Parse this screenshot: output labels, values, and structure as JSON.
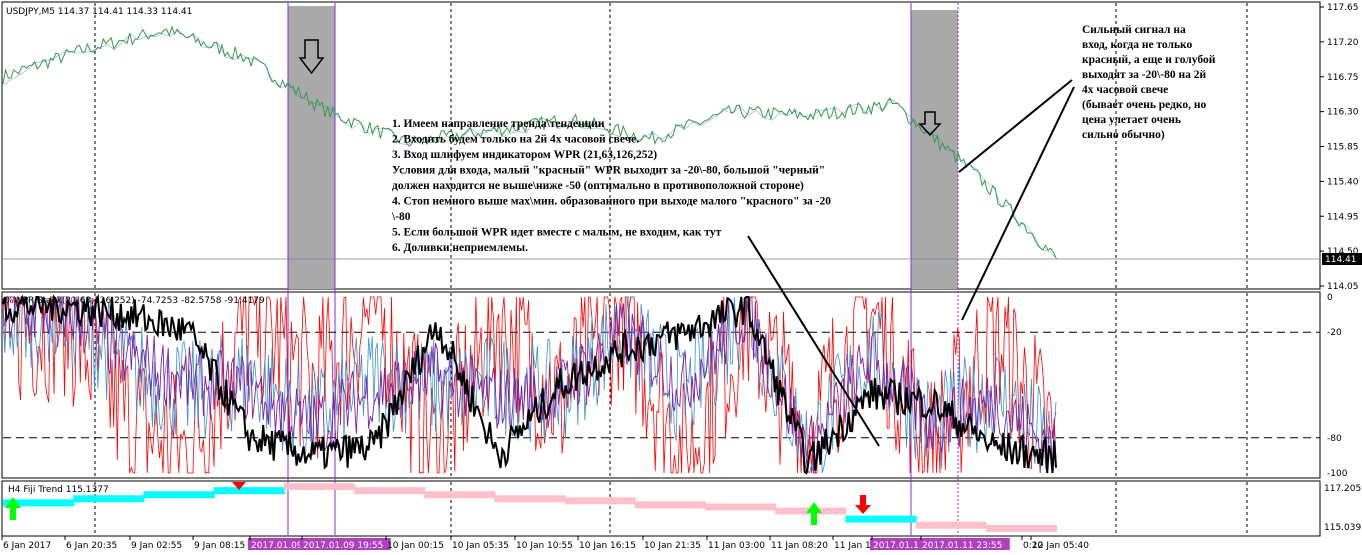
{
  "colors": {
    "price_line": "#3a9a44",
    "price_line_alt": "#2f7fbf",
    "wpr_big": "#000000",
    "wpr_small": "#ff0000",
    "wpr_blue": "#3f8fd0",
    "wpr_purple": "#8020a0",
    "trend_up": "#00ffff",
    "trend_down": "#ffc0cb",
    "highlight_zone": "#a9a9a9",
    "vline": "#8a2be2",
    "arrow_up": "#00ff00",
    "arrow_down": "#ff0000",
    "cursor_label_bg": "#b040c0"
  },
  "main_panel": {
    "symbol_label": "USDJPY,M5  114.37 114.41 114.33 114.41",
    "price_ticks": [
      "117.65",
      "117.20",
      "116.75",
      "116.30",
      "115.85",
      "115.40",
      "114.95",
      "114.50",
      "114.05"
    ],
    "current_price": "114.41",
    "annotation_left": [
      "1. Имеем направление тренда\\тенденции",
      "2. Входить будем только на 2й 4х часовой свече.",
      "3. Вход шлифуем индикатором WPR (21,63,126,252)",
      "Условия для входа, малый \"красный\" WPR выходит за -20\\-80, большой \"черный\"",
      "должен находится не выше\\ниже -50 (оптимально в противоположной стороне)",
      "4. Стоп немного выше мах\\мин. образованного при выходе малого \"красного\" за -20",
      "\\-80",
      "5. Если большой WPR идет вместе с малым, не входим, как тут",
      "6. Доливки неприемлемы."
    ],
    "annotation_right": [
      "Сильный сигнал на",
      "вход, когда не только",
      "красный, а еще и голубой",
      "выходят за -20\\-80 на 2й",
      "4х часовой свече",
      "(бывает очень редко, но",
      "цена улетает очень",
      "сильно обычно)"
    ]
  },
  "wpr_panel": {
    "label": "%WPR Stack(21,63,126,252) -74.7253 -82.5758 -91.4179",
    "ticks": [
      "0",
      "-20",
      "-80",
      "-100"
    ]
  },
  "trend_panel": {
    "label": "H4 Fiji Trend 115.1377",
    "ticks": [
      "117.2059",
      "115.0392"
    ]
  },
  "time_axis": [
    "6 Jan 2017",
    "6 Jan 20:35",
    "9 Jan 02:55",
    "9 Jan 08:15",
    "2017.01.09",
    "2017.01.09 19:55",
    "10 Jan 00:15",
    "10 Jan 05:35",
    "10 Jan 10:55",
    "10 Jan 16:15",
    "10 Jan 21:35",
    "11 Jan 03:00",
    "11 Jan 08:20",
    "11 Jan 1",
    "2017.01.11",
    "2017.01.11 23:55",
    "0:20",
    "12 Jan 05:40"
  ],
  "chart_data": [
    {
      "type": "line",
      "title": "USDJPY,M5",
      "ylim": [
        114.05,
        117.65
      ],
      "x": [
        "6 Jan 2017",
        "6 Jan 20:35",
        "9 Jan 02:55",
        "9 Jan 08:15",
        "2017.01.09 19:55",
        "10 Jan 00:15",
        "10 Jan 05:35",
        "10 Jan 10:55",
        "10 Jan 16:15",
        "10 Jan 21:35",
        "11 Jan 03:00",
        "11 Jan 08:20",
        "2017.01.11 23:55",
        "12 Jan 05:40"
      ],
      "series": [
        {
          "name": "USDJPY",
          "values": [
            116.75,
            117.1,
            117.35,
            117.0,
            116.3,
            115.9,
            116.05,
            116.2,
            115.95,
            116.3,
            116.25,
            116.4,
            115.5,
            114.41
          ]
        }
      ]
    },
    {
      "type": "line",
      "title": "%WPR Stack(21,63,126,252)",
      "ylim": [
        -100,
        0
      ],
      "series": [
        {
          "name": "21",
          "values": [
            -20,
            -10,
            -70,
            -90,
            -10,
            -50,
            -5,
            -90,
            -10,
            -60,
            -5,
            -95,
            -10,
            -80,
            -5,
            -90,
            -20,
            -85
          ]
        },
        {
          "name": "252",
          "values": [
            -5,
            -5,
            -10,
            -20,
            -80,
            -90,
            -85,
            -15,
            -90,
            -50,
            -30,
            -20,
            -5,
            -95,
            -55,
            -60,
            -85,
            -91.4179
          ]
        }
      ]
    },
    {
      "type": "line",
      "title": "H4 Fiji Trend",
      "ylim": [
        115.0392,
        117.2059
      ],
      "series": [
        {
          "name": "H4 Fiji Trend",
          "values": [
            116.4,
            116.6,
            116.8,
            117.0,
            117.2,
            117.0,
            116.8,
            116.6,
            116.5,
            116.3,
            116.2,
            116.0,
            115.9,
            115.3,
            115.1377
          ]
        }
      ]
    }
  ]
}
